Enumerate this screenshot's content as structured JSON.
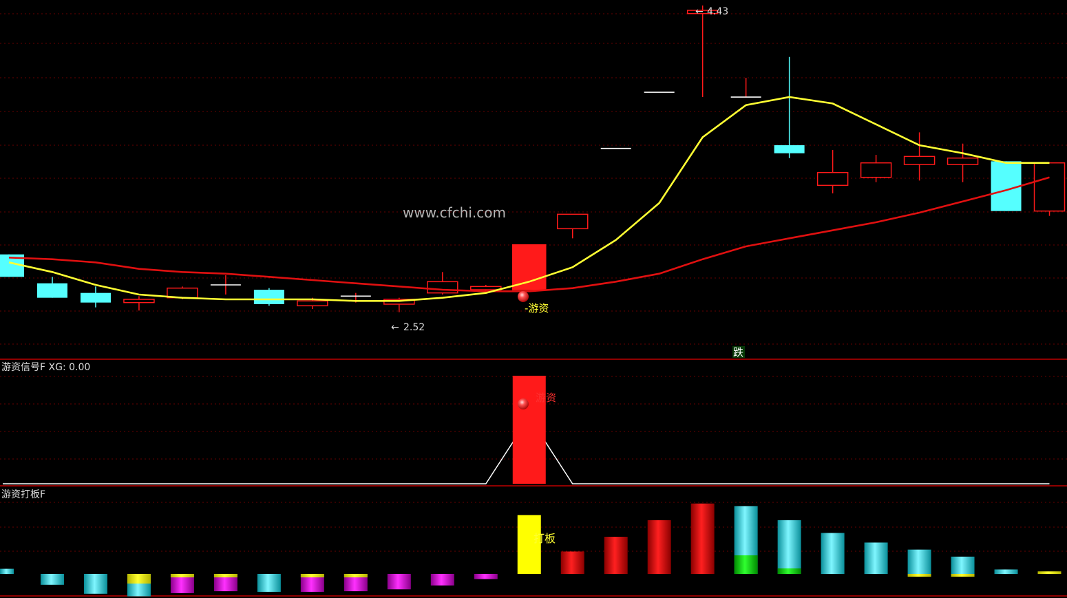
{
  "watermark": "www.cfchi.com",
  "price_panel": {
    "grid_levels": [
      20,
      63,
      113,
      162,
      211,
      259,
      308,
      356,
      404,
      452,
      500
    ],
    "low_label": "2.52",
    "high_label": "4.43",
    "signal_label": "-游资",
    "fall_label": "跌"
  },
  "signal_panel": {
    "title": "游资信号F  XG: 0.00",
    "signal_label": "游资"
  },
  "board_panel": {
    "title": "游资打板F",
    "label": "打板"
  },
  "colors": {
    "up": "#ff1a1a",
    "down": "#55ffff",
    "ma_short": "#ffff33",
    "ma_long": "#e01010",
    "grid": "#6a0000",
    "separator": "#c00000",
    "watermark": "#b5b5b5"
  },
  "chart_data": [
    {
      "type": "candlestick",
      "note": "",
      "candles": [
        {
          "open": 2.88,
          "close": 2.74,
          "high": 2.88,
          "low": 2.74
        },
        {
          "open": 2.7,
          "close": 2.61,
          "high": 2.74,
          "low": 2.61
        },
        {
          "open": 2.64,
          "close": 2.58,
          "high": 2.68,
          "low": 2.55
        },
        {
          "open": 2.58,
          "close": 2.6,
          "high": 2.62,
          "low": 2.53
        },
        {
          "open": 2.61,
          "close": 2.67,
          "high": 2.68,
          "low": 2.6
        },
        {
          "open": 2.69,
          "close": 2.69,
          "high": 2.75,
          "low": 2.63
        },
        {
          "open": 2.66,
          "close": 2.57,
          "high": 2.67,
          "low": 2.56
        },
        {
          "open": 2.56,
          "close": 2.59,
          "high": 2.61,
          "low": 2.54
        },
        {
          "open": 2.62,
          "close": 2.62,
          "high": 2.64,
          "low": 2.58
        },
        {
          "open": 2.57,
          "close": 2.6,
          "high": 2.61,
          "low": 2.52
        },
        {
          "open": 2.64,
          "close": 2.71,
          "high": 2.77,
          "low": 2.63
        },
        {
          "open": 2.66,
          "close": 2.68,
          "high": 2.69,
          "low": 2.65
        },
        {
          "open": 2.66,
          "close": 2.94,
          "high": 2.94,
          "low": 2.66
        },
        {
          "open": 3.04,
          "close": 3.13,
          "high": 3.13,
          "low": 2.98
        },
        {
          "open": 3.54,
          "close": 3.54,
          "high": 3.54,
          "low": 3.54
        },
        {
          "open": 3.89,
          "close": 3.89,
          "high": 3.89,
          "low": 3.89
        },
        {
          "open": 4.38,
          "close": 4.4,
          "high": 4.43,
          "low": 3.86
        },
        {
          "open": 3.86,
          "close": 3.86,
          "high": 3.98,
          "low": 3.86
        },
        {
          "open": 3.56,
          "close": 3.51,
          "high": 4.11,
          "low": 3.48
        },
        {
          "open": 3.31,
          "close": 3.39,
          "high": 3.53,
          "low": 3.26
        },
        {
          "open": 3.36,
          "close": 3.45,
          "high": 3.5,
          "low": 3.33
        },
        {
          "open": 3.44,
          "close": 3.49,
          "high": 3.64,
          "low": 3.34
        },
        {
          "open": 3.44,
          "close": 3.48,
          "high": 3.57,
          "low": 3.33
        },
        {
          "open": 3.46,
          "close": 3.15,
          "high": 3.46,
          "low": 3.15
        },
        {
          "open": 3.15,
          "close": 3.45,
          "high": 3.45,
          "low": 3.12
        }
      ],
      "ma_short": [
        2.83,
        2.77,
        2.69,
        2.63,
        2.61,
        2.6,
        2.6,
        2.6,
        2.59,
        2.59,
        2.61,
        2.64,
        2.71,
        2.8,
        2.97,
        3.2,
        3.61,
        3.81,
        3.86,
        3.82,
        3.69,
        3.56,
        3.51,
        3.45,
        3.45
      ],
      "ma_long": [
        2.86,
        2.85,
        2.83,
        2.79,
        2.77,
        2.76,
        2.74,
        2.72,
        2.7,
        2.68,
        2.66,
        2.65,
        2.65,
        2.67,
        2.71,
        2.76,
        2.85,
        2.93,
        2.98,
        3.03,
        3.08,
        3.14,
        3.21,
        3.28,
        3.36
      ]
    },
    {
      "type": "line",
      "title": "游资信号F",
      "values": [
        0,
        0,
        0,
        0,
        0,
        0,
        0,
        0,
        0,
        0,
        0,
        0,
        1,
        0,
        0,
        0,
        0,
        0,
        0,
        0,
        0,
        0,
        0,
        0,
        0
      ],
      "signal_index": 12
    },
    {
      "type": "bar",
      "title": "游资打板F",
      "values": [
        0.08,
        -0.17,
        -0.31,
        -0.35,
        -0.3,
        -0.27,
        -0.28,
        -0.28,
        -0.27,
        -0.24,
        -0.18,
        -0.08,
        0.92,
        0.35,
        0.58,
        0.84,
        1.1,
        1.06,
        0.84,
        0.64,
        0.49,
        0.38,
        0.27,
        0.07,
        0.04
      ],
      "colors": [
        "cyan",
        "cyan",
        "cyan",
        "yellow-cyan",
        "magenta",
        "magenta",
        "cyan",
        "magenta",
        "magenta",
        "magenta",
        "magenta",
        "magenta",
        "yellow",
        "red",
        "red",
        "red",
        "red",
        "cyan-green",
        "cyan-green",
        "cyan",
        "cyan",
        "cyan-yellow",
        "cyan-yellow",
        "cyan",
        "yellow"
      ],
      "label_index": 12
    }
  ]
}
